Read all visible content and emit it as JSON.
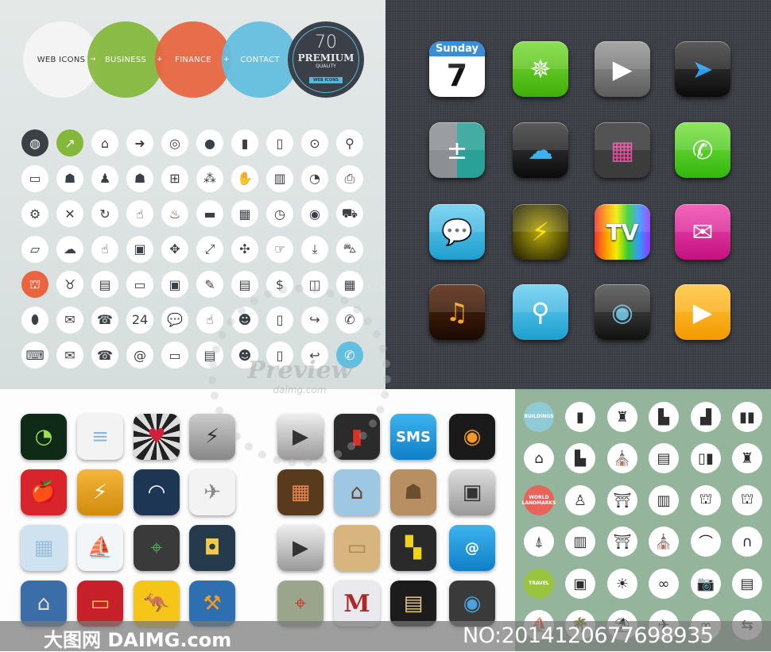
{
  "header": {
    "circles": [
      {
        "label": "WEB ICONS",
        "color": "#f4f4f4",
        "text": "#333333"
      },
      {
        "label": "BUSINESS",
        "color": "#84b83a",
        "text": "#ffffff"
      },
      {
        "label": "FINANCE",
        "color": "#e9643f",
        "text": "#ffffff"
      },
      {
        "label": "CONTACT",
        "color": "#62bfdf",
        "text": "#ffffff"
      }
    ],
    "operators": [
      "→",
      "+",
      "+",
      "="
    ],
    "badge": {
      "number": "70",
      "title": "PREMIUM",
      "subtitle": "QUALITY",
      "ribbon": "WEB ICONS"
    }
  },
  "web_icons": [
    {
      "icon": "world-map",
      "g": "◍",
      "bg": "#3b3f46",
      "fg": "#fff"
    },
    {
      "icon": "chart-up",
      "g": "↗",
      "bg": "#84b83a",
      "fg": "#fff"
    },
    {
      "icon": "home",
      "g": "⌂"
    },
    {
      "icon": "arrow-right-circle",
      "g": "➜"
    },
    {
      "icon": "globe",
      "g": "◎"
    },
    {
      "icon": "user",
      "g": "●"
    },
    {
      "icon": "lock",
      "g": "▮"
    },
    {
      "icon": "unlock",
      "g": "▯"
    },
    {
      "icon": "map-pin",
      "g": "⊙"
    },
    {
      "icon": "search",
      "g": "⚲"
    },
    {
      "icon": "presentation",
      "g": "▭"
    },
    {
      "icon": "team",
      "g": "☗"
    },
    {
      "icon": "podium-speaker",
      "g": "♟"
    },
    {
      "icon": "businessman",
      "g": "☗"
    },
    {
      "icon": "org-chart",
      "g": "⊞"
    },
    {
      "icon": "network-people",
      "g": "⁂"
    },
    {
      "icon": "handshake",
      "g": "✋"
    },
    {
      "icon": "bar-chart",
      "g": "▥"
    },
    {
      "icon": "pie-chart",
      "g": "◔"
    },
    {
      "icon": "printer",
      "g": "⎙"
    },
    {
      "icon": "gears",
      "g": "⚙"
    },
    {
      "icon": "tools",
      "g": "✕"
    },
    {
      "icon": "refresh",
      "g": "↻"
    },
    {
      "icon": "thumbs-up",
      "g": "☝"
    },
    {
      "icon": "lightbulb",
      "g": "♨"
    },
    {
      "icon": "briefcase",
      "g": "▬"
    },
    {
      "icon": "calendar",
      "g": "▦"
    },
    {
      "icon": "clock",
      "g": "◷"
    },
    {
      "icon": "target",
      "g": "◉"
    },
    {
      "icon": "truck",
      "g": "⛟"
    },
    {
      "icon": "folder-open",
      "g": "▱"
    },
    {
      "icon": "cloud-user",
      "g": "☁"
    },
    {
      "icon": "hand-pointer",
      "g": "☝"
    },
    {
      "icon": "touch-screen",
      "g": "▣"
    },
    {
      "icon": "hand-drag",
      "g": "✥"
    },
    {
      "icon": "expand",
      "g": "⤢"
    },
    {
      "icon": "collapse",
      "g": "✣"
    },
    {
      "icon": "hand-point-right",
      "g": "☞"
    },
    {
      "icon": "download",
      "g": "⤓"
    },
    {
      "icon": "shopping-cart",
      "g": "⛍"
    },
    {
      "icon": "bank",
      "g": "⛫",
      "bg": "#e9643f",
      "fg": "#fff"
    },
    {
      "icon": "piggy-bank",
      "g": "♉"
    },
    {
      "icon": "cash",
      "g": "▤"
    },
    {
      "icon": "atm-card",
      "g": "▭"
    },
    {
      "icon": "safe",
      "g": "▣"
    },
    {
      "icon": "document-sign",
      "g": "✎"
    },
    {
      "icon": "banknote",
      "g": "▤"
    },
    {
      "icon": "dollar-coin",
      "g": "$"
    },
    {
      "icon": "wallet",
      "g": "◫"
    },
    {
      "icon": "calculator",
      "g": "▦"
    },
    {
      "icon": "mouse",
      "g": "⬮"
    },
    {
      "icon": "envelope",
      "g": "✉"
    },
    {
      "icon": "telephone",
      "g": "☎"
    },
    {
      "icon": "support-24h",
      "g": "24"
    },
    {
      "icon": "chat-bubbles",
      "g": "💬"
    },
    {
      "icon": "hand-click",
      "g": "☝"
    },
    {
      "icon": "call-center-agent",
      "g": "☻"
    },
    {
      "icon": "mobile-chat",
      "g": "▯"
    },
    {
      "icon": "phone-forward",
      "g": "↪"
    },
    {
      "icon": "phone",
      "g": "✆"
    },
    {
      "icon": "laptop",
      "g": "⌨"
    },
    {
      "icon": "open-envelope",
      "g": "✉"
    },
    {
      "icon": "desk-phone",
      "g": "☎"
    },
    {
      "icon": "at-sign",
      "g": "@"
    },
    {
      "icon": "speech-bubble",
      "g": "▭"
    },
    {
      "icon": "contact-card",
      "g": "▤"
    },
    {
      "icon": "headset-operator",
      "g": "☻"
    },
    {
      "icon": "mobile-message",
      "g": "▯"
    },
    {
      "icon": "phone-transfer",
      "g": "↩"
    },
    {
      "icon": "phone-ring",
      "g": "✆",
      "bg": "#62bfdf",
      "fg": "#fff"
    }
  ],
  "ios_icons": [
    {
      "icon": "calendar",
      "bg": "#ffffff",
      "day": "Sunday",
      "date": "7"
    },
    {
      "icon": "compass",
      "g": "✵",
      "bg": "linear-gradient(#7fdc3c,#3fae08)"
    },
    {
      "icon": "video-player",
      "g": "▶",
      "bg": "linear-gradient(#9a9a9a,#5d5d5d)"
    },
    {
      "icon": "location-arrow",
      "g": "➤",
      "bg": "linear-gradient(#444,#0a0a0a)",
      "fg": "#2a9ff0"
    },
    {
      "icon": "calculator",
      "g": "±",
      "bg": "linear-gradient(90deg,#8c9094 50%,#2aa197 50%)"
    },
    {
      "icon": "cloud",
      "g": "☁",
      "bg": "linear-gradient(#444,#0a0a0a)",
      "fg": "#3ab3f2"
    },
    {
      "icon": "app-grid",
      "g": "▦",
      "bg": "#3c3c3c",
      "fg": "#e14b9c"
    },
    {
      "icon": "phone",
      "g": "✆",
      "bg": "linear-gradient(#7ee34a,#32b70c)"
    },
    {
      "icon": "messages",
      "g": "💬",
      "bg": "linear-gradient(#6fd0f2,#1d9fcf)"
    },
    {
      "icon": "lightning",
      "g": "⚡",
      "bg": "radial-gradient(#b7a80a,#1c1a05)",
      "fg": "#ffe000"
    },
    {
      "icon": "tv",
      "label": "TV",
      "bg": "linear-gradient(90deg,#e33,#f90,#ee0,#3c3,#39f,#93f)"
    },
    {
      "icon": "mail",
      "g": "✉",
      "bg": "linear-gradient(#f24fb3,#c3117f)"
    },
    {
      "icon": "music",
      "g": "♫",
      "bg": "linear-gradient(#5a2a10,#1a0a02)",
      "fg": "#f5a623"
    },
    {
      "icon": "search",
      "g": "⚲",
      "bg": "linear-gradient(#6fd0f2,#1d9fcf)"
    },
    {
      "icon": "camera",
      "g": "◉",
      "bg": "linear-gradient(#555,#111)",
      "fg": "#6ab7d4"
    },
    {
      "icon": "play",
      "g": "▶",
      "bg": "linear-gradient(#ffc740,#f39a00)"
    }
  ],
  "app_icons": [
    {
      "icon": "speedometer-gauge",
      "g": "◔",
      "bg": "#0f2a17",
      "fg": "#9be14c"
    },
    {
      "icon": "notepad",
      "g": "≡",
      "bg": "#f3f3f3",
      "fg": "#8fb6d9"
    },
    {
      "icon": "hearts",
      "g": "♥",
      "bg": "repeating-conic-gradient(#222 0 15deg,#ddd 15deg 30deg)",
      "fg": "#d21f3c"
    },
    {
      "icon": "battery-charge",
      "g": "⚡",
      "bg": "linear-gradient(#ccc,#888)",
      "fg": "#333"
    },
    {
      "icon": "play-button",
      "g": "▶",
      "bg": "linear-gradient(#eee,#999)",
      "fg": "#333"
    },
    {
      "icon": "power-switch",
      "g": "▮",
      "bg": "#2b2b2b",
      "fg": "#d8322b"
    },
    {
      "icon": "sms",
      "label": "SMS",
      "bg": "linear-gradient(#3db3ee,#0f7fc8)",
      "fg": "#fff"
    },
    {
      "icon": "vinyl-record",
      "g": "◉",
      "bg": "#1a1a1a",
      "fg": "#f39a23"
    },
    {
      "icon": "fruits",
      "g": "🍎",
      "bg": "#d8252b",
      "fg": "#f5d533"
    },
    {
      "icon": "battery",
      "g": "⚡",
      "bg": "linear-gradient(#f4b63a,#d08b0c)",
      "fg": "#fff"
    },
    {
      "icon": "meter",
      "g": "◠",
      "bg": "#1c3654",
      "fg": "#fff"
    },
    {
      "icon": "paper-plane",
      "g": "✈",
      "bg": "#f3f3f3",
      "fg": "#888"
    },
    {
      "icon": "retro-tv",
      "g": "▦",
      "bg": "#5a3a1c",
      "fg": "#e85"
    },
    {
      "icon": "house",
      "g": "⌂",
      "bg": "#9ec7e3",
      "fg": "#6b4424"
    },
    {
      "icon": "contacts-book",
      "g": "☗",
      "bg": "#b88f62",
      "fg": "#6b4e2e"
    },
    {
      "icon": "ethernet-port",
      "g": "▣",
      "bg": "linear-gradient(#ddd,#999)",
      "fg": "#333"
    },
    {
      "icon": "graph-paper",
      "g": "▦",
      "bg": "#cfe2f0",
      "fg": "#9bbfd8"
    },
    {
      "icon": "sailboat",
      "g": "⛵",
      "bg": "#f2f6f8",
      "fg": "#d8322b"
    },
    {
      "icon": "map",
      "g": "⌖",
      "bg": "#3a3a3a",
      "fg": "#4caf50"
    },
    {
      "icon": "target-board",
      "g": "◘",
      "bg": "#263a4d",
      "fg": "#f2c94c"
    },
    {
      "icon": "video-player",
      "g": "▶",
      "bg": "linear-gradient(#eee,#999)",
      "fg": "#333"
    },
    {
      "icon": "folder",
      "g": "▭",
      "bg": "#d8b57e",
      "fg": "#a98552"
    },
    {
      "icon": "checkered-flag",
      "g": "▚",
      "bg": "#2a2a2a",
      "fg": "#f2d31b"
    },
    {
      "icon": "email-at",
      "label": "@",
      "bg": "linear-gradient(#3db3ee,#0f7fc8)",
      "fg": "#fff"
    },
    {
      "icon": "house-cottage",
      "g": "⌂",
      "bg": "#3b6ea8",
      "fg": "#e8dcc0"
    },
    {
      "icon": "credit-card",
      "g": "▭",
      "bg": "#c7202a",
      "fg": "#f2c94c"
    },
    {
      "icon": "kangaroo-sign",
      "g": "🦘",
      "bg": "#f5c518",
      "fg": "#111"
    },
    {
      "icon": "workshop",
      "g": "⚒",
      "bg": "#2d6fb0",
      "fg": "#f39a23"
    },
    {
      "icon": "map-road",
      "g": "⌖",
      "bg": "#9aa58c",
      "fg": "#d8322b"
    },
    {
      "icon": "gmail",
      "label": "M",
      "bg": "#e9e9ee",
      "fg": "#b0262b"
    },
    {
      "icon": "film-strip",
      "g": "▤",
      "bg": "#1c1c1c",
      "fg": "#e8c98a"
    },
    {
      "icon": "webcam",
      "g": "◉",
      "bg": "#3a3a3a",
      "fg": "#4aa3df"
    }
  ],
  "landmarks": [
    {
      "label": "BUILDINGS",
      "bg": "#8fcbd6"
    },
    {
      "icon": "skyscraper",
      "g": "▮"
    },
    {
      "icon": "castle",
      "g": "♜"
    },
    {
      "icon": "office-buildings",
      "g": "▙"
    },
    {
      "icon": "factory-smoke",
      "g": "▟"
    },
    {
      "icon": "twin-towers",
      "g": "▮▮"
    },
    {
      "icon": "house",
      "g": "⌂"
    },
    {
      "icon": "factory",
      "g": "▙"
    },
    {
      "icon": "town-hall",
      "g": "⛪"
    },
    {
      "icon": "apartment",
      "g": "▤"
    },
    {
      "icon": "city-towers",
      "g": "▯▮"
    },
    {
      "icon": "cathedral",
      "g": "♜"
    },
    {
      "label": "WORLD LANDMARKS",
      "bg": "#e8635a"
    },
    {
      "icon": "statue-of-liberty",
      "g": "♙"
    },
    {
      "icon": "taj-mahal",
      "g": "⛩"
    },
    {
      "icon": "leaning-tower-pisa",
      "g": "▥"
    },
    {
      "icon": "parthenon",
      "g": "⛫"
    },
    {
      "icon": "capitol",
      "g": "⛫"
    },
    {
      "icon": "eiffel-tower",
      "g": "⍋"
    },
    {
      "icon": "colosseum",
      "g": "▥"
    },
    {
      "icon": "torii-gate",
      "g": "⛩"
    },
    {
      "icon": "kremlin",
      "g": "⛪"
    },
    {
      "icon": "golden-gate-bridge",
      "g": "⌒"
    },
    {
      "icon": "arc-de-triomphe",
      "g": "∩"
    },
    {
      "label": "TRAVEL",
      "bg": "#9ac43f"
    },
    {
      "icon": "suitcase",
      "g": "▣"
    },
    {
      "icon": "sun",
      "g": "☀"
    },
    {
      "icon": "snorkel-mask",
      "g": "∞"
    },
    {
      "icon": "camera",
      "g": "📷"
    },
    {
      "icon": "passport",
      "g": "▤"
    },
    {
      "icon": "sailboat",
      "g": "⛵"
    },
    {
      "icon": "palm-tree",
      "g": "🌴"
    },
    {
      "icon": "beach-umbrella",
      "g": "⛱"
    },
    {
      "icon": "airplane",
      "g": "✈"
    },
    {
      "icon": "bikini",
      "g": "∞"
    },
    {
      "icon": "signpost",
      "g": "⇆"
    }
  ],
  "watermark": {
    "title": "Preview",
    "site": "daimg.com"
  },
  "footer": {
    "brand": "大图网 DAIMG.com",
    "number": "NO:20141206776989​35"
  }
}
